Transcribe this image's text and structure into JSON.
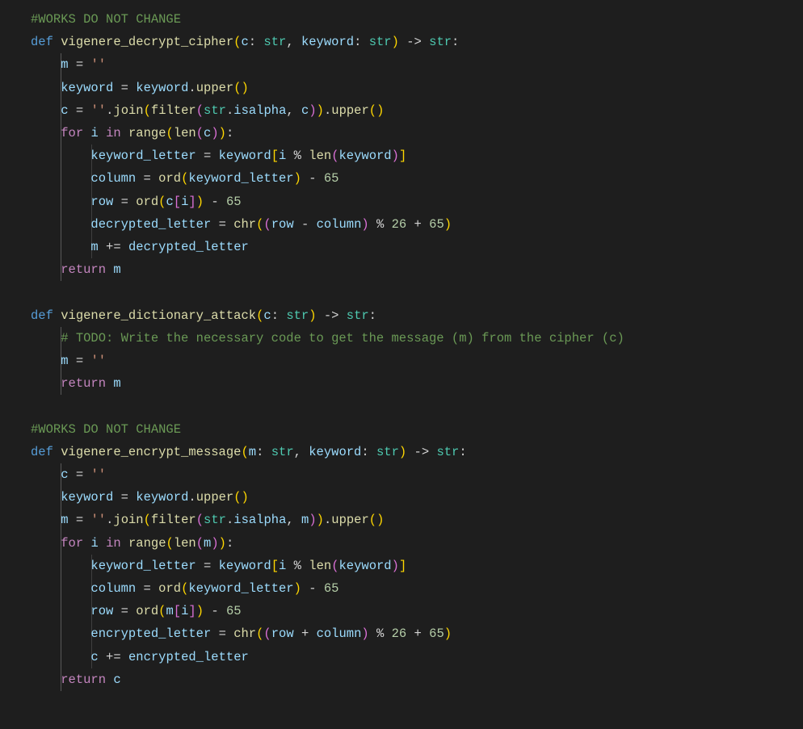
{
  "comments": {
    "works1": "#WORKS DO NOT CHANGE",
    "works2": "#WORKS DO NOT CHANGE",
    "todo": "# TODO: Write the necessary code to get the message (m) from the cipher (c)"
  },
  "kw": {
    "def": "def",
    "for": "for",
    "in": "in",
    "return": "return"
  },
  "fns": {
    "decrypt": "vigenere_decrypt_cipher",
    "attack": "vigenere_dictionary_attack",
    "encrypt": "vigenere_encrypt_message",
    "upper": "upper",
    "join": "join",
    "filter": "filter",
    "isalpha": "isalpha",
    "range": "range",
    "len": "len",
    "ord": "ord",
    "chr": "chr"
  },
  "types": {
    "str": "str"
  },
  "vars": {
    "c": "c",
    "m": "m",
    "keyword": "keyword",
    "i": "i",
    "keyword_letter": "keyword_letter",
    "column": "column",
    "row": "row",
    "decrypted_letter": "decrypted_letter",
    "encrypted_letter": "encrypted_letter"
  },
  "strings": {
    "empty": "''"
  },
  "nums": {
    "n65": "65",
    "n26": "26"
  },
  "ops": {
    "arrow": "->",
    "colon": ":",
    "comma": ",",
    "assign": "=",
    "plusassign": "+=",
    "minus": "-",
    "plus": "+",
    "mod": "%",
    "dot": "."
  }
}
